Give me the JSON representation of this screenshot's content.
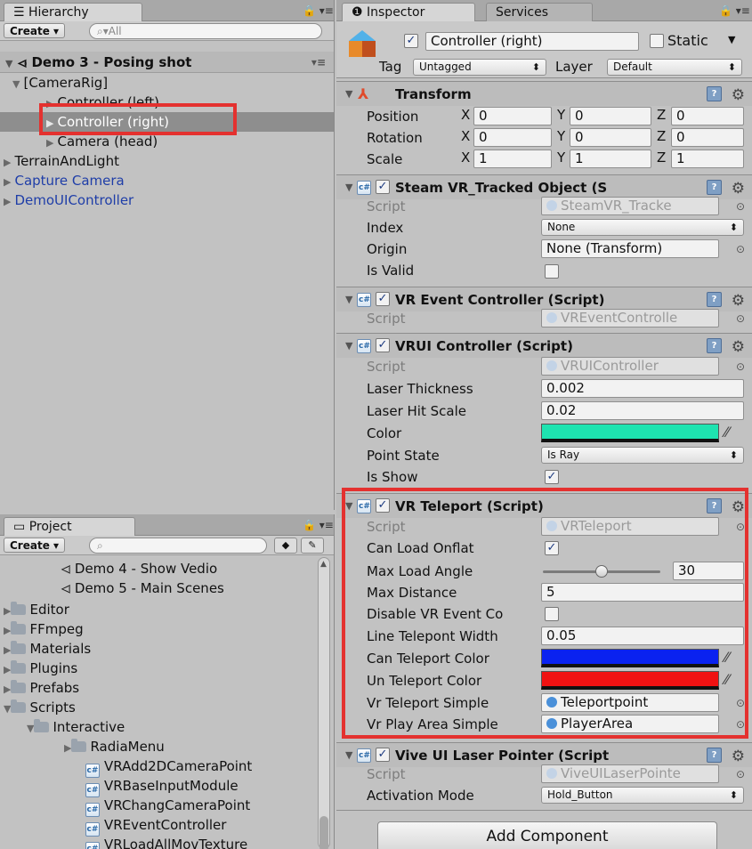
{
  "hierarchy": {
    "tab_label": "Hierarchy",
    "create_label": "Create",
    "search_placeholder": "All",
    "scene": "Demo 3 - Posing shot",
    "items": [
      {
        "label": "[CameraRig]"
      },
      {
        "label": "Controller (left)"
      },
      {
        "label": "Controller (right)"
      },
      {
        "label": "Camera (head)"
      },
      {
        "label": "TerrainAndLight"
      },
      {
        "label": "Capture Camera"
      },
      {
        "label": "DemoUIController"
      }
    ]
  },
  "project": {
    "tab_label": "Project",
    "create_label": "Create",
    "items": [
      {
        "label": "Demo 4 - Show Vedio"
      },
      {
        "label": "Demo 5 -  Main Scenes"
      },
      {
        "label": "Editor"
      },
      {
        "label": "FFmpeg"
      },
      {
        "label": "Materials"
      },
      {
        "label": "Plugins"
      },
      {
        "label": "Prefabs"
      },
      {
        "label": "Scripts"
      },
      {
        "label": "Interactive"
      },
      {
        "label": "RadiaMenu"
      },
      {
        "label": "VRAdd2DCameraPoint"
      },
      {
        "label": "VRBaseInputModule"
      },
      {
        "label": "VRChangCameraPoint"
      },
      {
        "label": "VREventController"
      },
      {
        "label": "VRLoadAllMovTexture"
      }
    ]
  },
  "inspector": {
    "tab_label": "Inspector",
    "services_label": "Services",
    "object_name": "Controller (right)",
    "static_label": "Static",
    "tag_label": "Tag",
    "tag_value": "Untagged",
    "layer_label": "Layer",
    "layer_value": "Default",
    "transform": {
      "title": "Transform",
      "position_label": "Position",
      "position": [
        "0",
        "0",
        "0"
      ],
      "rotation_label": "Rotation",
      "rotation": [
        "0",
        "0",
        "0"
      ],
      "scale_label": "Scale",
      "scale": [
        "1",
        "1",
        "1"
      ],
      "axis": [
        "X",
        "Y",
        "Z"
      ]
    },
    "tracked": {
      "title": "Steam VR_Tracked Object (S",
      "script_label": "Script",
      "script": "SteamVR_Tracke",
      "index_label": "Index",
      "index": "None",
      "origin_label": "Origin",
      "origin": "None (Transform)",
      "valid_label": "Is Valid"
    },
    "event_ctrl": {
      "title": "VR Event Controller (Script)",
      "script_label": "Script",
      "script": "VREventControlle"
    },
    "vrui": {
      "title": "VRUI Controller (Script)",
      "script_label": "Script",
      "script": "VRUIController",
      "thickness_label": "Laser Thickness",
      "thickness": "0.002",
      "hit_label": "Laser Hit Scale",
      "hit": "0.02",
      "color_label": "Color",
      "color": "#1ee3b0",
      "state_label": "Point State",
      "state": "Is Ray",
      "show_label": "Is Show"
    },
    "teleport": {
      "title": "VR Teleport (Script)",
      "script_label": "Script",
      "script": "VRTeleport",
      "onflat_label": "Can Load Onflat",
      "angle_label": "Max Load Angle",
      "angle": "30",
      "angle_fraction": 0.5,
      "distance_label": "Max Distance",
      "distance": "5",
      "disable_label": "Disable VR Event Co",
      "width_label": "Line Telepont Width",
      "width": "0.05",
      "can_color_label": "Can Teleport Color",
      "can_color": "#0a22f0",
      "un_color_label": "Un Teleport Color",
      "un_color": "#f01212",
      "simple_label": "Vr Teleport Simple",
      "simple": "Teleportpoint",
      "area_label": "Vr Play Area Simple",
      "area": "PlayerArea"
    },
    "laser": {
      "title": "Vive UI Laser Pointer (Script",
      "script_label": "Script",
      "script": "ViveUILaserPointe",
      "mode_label": "Activation Mode",
      "mode": "Hold_Button"
    },
    "add_component": "Add Component"
  }
}
